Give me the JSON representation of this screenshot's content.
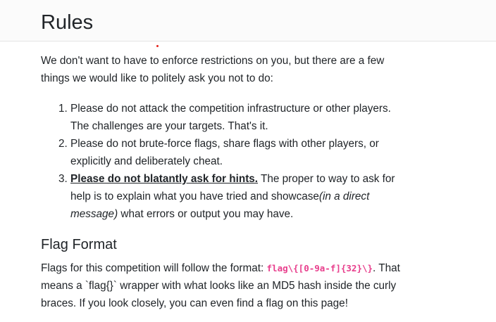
{
  "header": {
    "title": "Rules"
  },
  "intro": "We don't want to have to enforce restrictions on you, but there are a few things we would like to politely ask you not to do:",
  "rules": [
    {
      "text": "Please do not attack the competition infrastructure or other players. The challenges are your targets. That's it."
    },
    {
      "text": "Please do not brute-force flags, share flags with other players, or explicitly and deliberately cheat."
    },
    {
      "strong": "Please do not blatantly ask for hints.",
      "text_before_em": " The proper to way to ask for help is to explain what you have tried and showcase",
      "em": "(in a direct message)",
      "text_after_em": " what errors or output you may have."
    }
  ],
  "flag_format": {
    "heading": "Flag Format",
    "text_before_code": "Flags for this competition will follow the format: ",
    "code": "flag\\{[0-9a-f]{32}\\}",
    "text_after_code": ". That means a `flag{}` wrapper with what looks like an MD5 hash inside the curly braces. If you look closely, you can even find a flag on this page!"
  },
  "colors": {
    "code": "#e83e8c",
    "accent_dot": "#e5231b",
    "header_bg": "#fbfbfb"
  }
}
